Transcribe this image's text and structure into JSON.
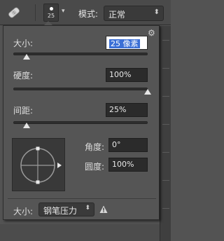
{
  "toolbar": {
    "brush_preset_size": "25",
    "preset_arrow": "▾",
    "mode_label": "模式:",
    "mode_value": "正常",
    "mode_arrow": "⬍"
  },
  "brush_panel": {
    "size": {
      "label": "大小:",
      "value": "25 像素",
      "slider_fraction": 0.1
    },
    "hardness": {
      "label": "硬度:",
      "value": "100%",
      "slider_fraction": 1.0
    },
    "spacing": {
      "label": "间距:",
      "value": "25%",
      "slider_fraction": 0.1
    },
    "angle": {
      "label": "角度:",
      "value": "0°"
    },
    "roundness": {
      "label": "圆度:",
      "value": "100%"
    },
    "control": {
      "label": "大小:",
      "value": "钢笔压力",
      "arrow": "⬍"
    },
    "gear_icon": "gear-icon",
    "warning_icon": "warning-icon"
  },
  "colors": {
    "panel_bg": "#555555",
    "field_bg": "#2b2b2b",
    "selection": "#3b6fd6"
  }
}
